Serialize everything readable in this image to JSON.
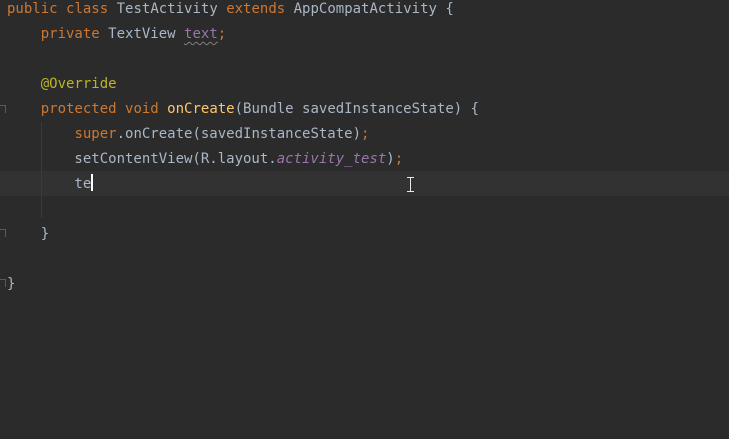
{
  "editor": {
    "lines": [
      [
        {
          "t": "public",
          "c": "kw"
        },
        {
          "t": " ",
          "c": "plain"
        },
        {
          "t": "class",
          "c": "kw"
        },
        {
          "t": " TestActivity ",
          "c": "plain"
        },
        {
          "t": "extends",
          "c": "kw"
        },
        {
          "t": " AppCompatActivity {",
          "c": "plain"
        }
      ],
      [
        {
          "t": "    ",
          "c": "plain"
        },
        {
          "t": "private",
          "c": "kw"
        },
        {
          "t": " TextView ",
          "c": "plain"
        },
        {
          "t": "text",
          "c": "field squiggle"
        },
        {
          "t": ";",
          "c": "kw"
        }
      ],
      [],
      [
        {
          "t": "    ",
          "c": "plain"
        },
        {
          "t": "@Override",
          "c": "anno"
        }
      ],
      [
        {
          "t": "    ",
          "c": "plain"
        },
        {
          "t": "protected",
          "c": "kw"
        },
        {
          "t": " ",
          "c": "plain"
        },
        {
          "t": "void",
          "c": "kw"
        },
        {
          "t": " ",
          "c": "plain"
        },
        {
          "t": "onCreate",
          "c": "fn"
        },
        {
          "t": "(Bundle savedInstanceState) {",
          "c": "plain"
        }
      ],
      [
        {
          "t": "        ",
          "c": "plain"
        },
        {
          "t": "super",
          "c": "kw"
        },
        {
          "t": ".onCreate(savedInstanceState)",
          "c": "plain"
        },
        {
          "t": ";",
          "c": "kw"
        }
      ],
      [
        {
          "t": "        setContentView(R.layout.",
          "c": "plain"
        },
        {
          "t": "activity_test",
          "c": "italic-field"
        },
        {
          "t": ")",
          "c": "plain"
        },
        {
          "t": ";",
          "c": "kw"
        }
      ],
      [
        {
          "t": "        te",
          "c": "plain"
        }
      ],
      [],
      [
        {
          "t": "    }",
          "c": "plain"
        }
      ],
      [],
      [
        {
          "t": "}",
          "c": "plain"
        }
      ]
    ],
    "caret_line": 7,
    "colors": {
      "background": "#2b2b2b",
      "caret_row": "#323232",
      "keyword": "#cc7832",
      "text": "#a9b7c6",
      "field": "#9876aa",
      "method": "#ffc66d",
      "annotation": "#bbb529"
    },
    "icons": {
      "mouse_pointer": "ibeam-cursor-icon",
      "fold_marker": "fold-marker-icon"
    }
  }
}
